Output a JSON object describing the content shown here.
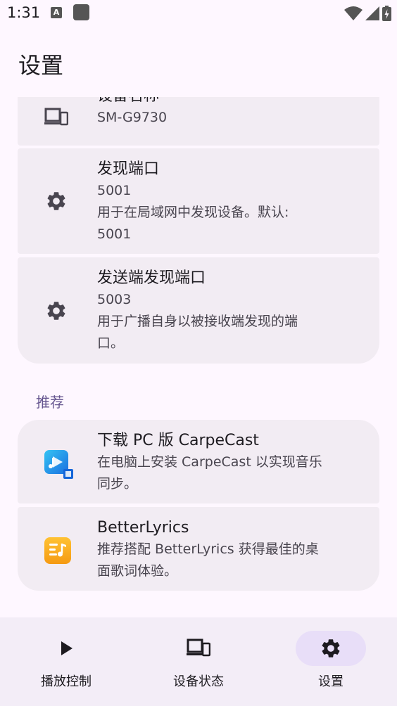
{
  "status_bar": {
    "time": "1:31",
    "notif_letter": "A"
  },
  "app": {
    "title": "设置"
  },
  "settings": [
    {
      "title": "设备名称",
      "lines": [
        "SM-G9730"
      ],
      "icon": "devices-icon"
    },
    {
      "title": "发现端口",
      "lines": [
        "5001",
        "用于在局域网中发现设备。默认:",
        "5001"
      ],
      "icon": "gear-icon"
    },
    {
      "title": "发送端发现端口",
      "lines": [
        "5003",
        "用于广播自身以被接收端发现的端",
        "口。"
      ],
      "icon": "gear-icon"
    }
  ],
  "recommend": {
    "section_label": "推荐",
    "items": [
      {
        "title": "下载 PC 版 CarpeCast",
        "lines": [
          "在电脑上安装 CarpeCast 以实现音乐",
          "同步。"
        ],
        "icon": "carpecast-app-icon"
      },
      {
        "title": "BetterLyrics",
        "lines": [
          "推荐搭配 BetterLyrics 获得最佳的桌",
          "面歌词体验。"
        ],
        "icon": "betterlyrics-app-icon"
      }
    ]
  },
  "nav": {
    "items": [
      {
        "label": "播放控制",
        "icon": "play-icon",
        "active": false
      },
      {
        "label": "设备状态",
        "icon": "devices-icon",
        "active": false
      },
      {
        "label": "设置",
        "icon": "gear-icon",
        "active": true
      }
    ]
  },
  "colors": {
    "background": "#fef7ff",
    "card": "#f2ecf3",
    "accent": "#65558f",
    "nav_background": "#f3edf7",
    "nav_active": "#e8def8"
  }
}
